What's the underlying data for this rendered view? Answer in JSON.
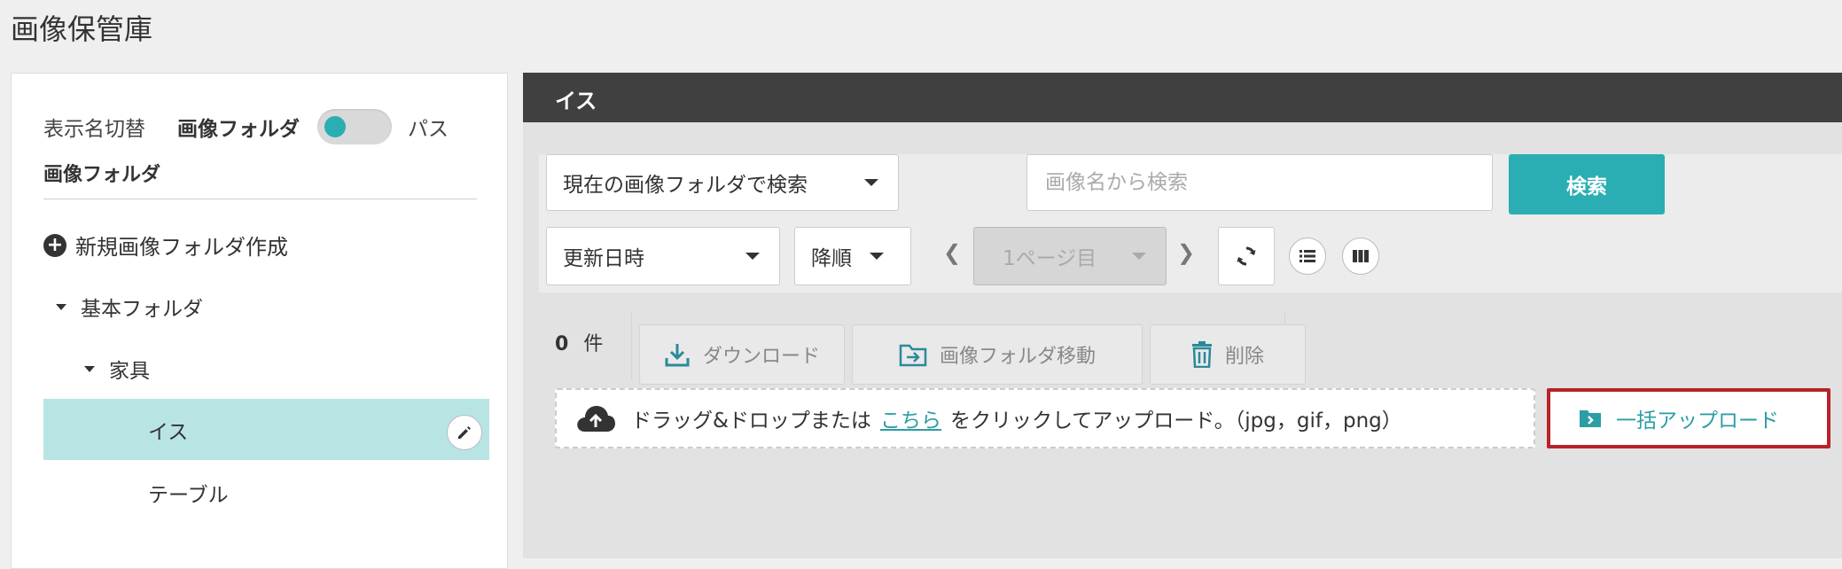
{
  "app": {
    "title": "画像保管庫"
  },
  "sidebar": {
    "toggle": {
      "label": "表示名切替",
      "option_on": "画像フォルダ",
      "option_off": "パス"
    },
    "heading": "画像フォルダ",
    "new_folder_label": "新規画像フォルダ作成",
    "tree": [
      {
        "label": "基本フォルダ",
        "level": 0,
        "expanded": true
      },
      {
        "label": "家具",
        "level": 1,
        "expanded": true
      },
      {
        "label": "イス",
        "level": 2,
        "selected": true
      },
      {
        "label": "テーブル",
        "level": 2,
        "selected": false
      }
    ]
  },
  "main": {
    "folder_title": "イス",
    "search": {
      "scope_selected": "現在の画像フォルダで検索",
      "name_placeholder": "画像名から検索",
      "button_label": "検索",
      "sort_field": "更新日時",
      "sort_order": "降順",
      "page_label": "1ページ目"
    },
    "results": {
      "count": "0",
      "count_unit": "件",
      "actions": {
        "download": "ダウンロード",
        "move": "画像フォルダ移動",
        "delete": "削除"
      }
    },
    "upload": {
      "text_before": "ドラッグ&ドロップまたは",
      "link_text": "こちら",
      "text_after": "をクリックしてアップロード。（jpg，gif，png）",
      "bulk_label": "一括アップロード"
    }
  },
  "colors": {
    "accent": "#2aaeb3",
    "header": "#404040",
    "highlight": "#b9e4e4",
    "focus_border": "#b82228"
  }
}
